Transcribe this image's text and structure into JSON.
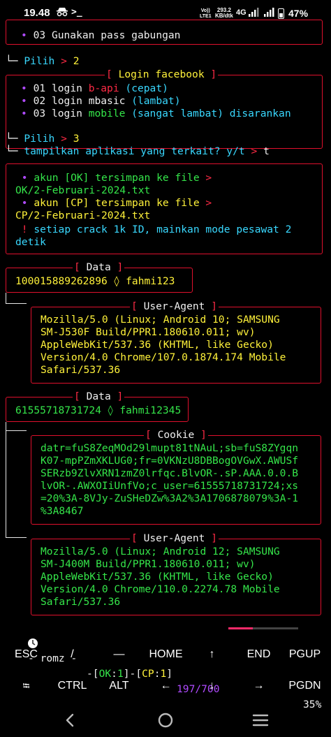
{
  "status": {
    "time": "19.48",
    "volte_top": "Vo))",
    "volte_bottom": "LTE1",
    "speed_top": "293.2",
    "speed_bottom": "KB/dtk",
    "network": "4G",
    "battery": "47%"
  },
  "terminal": {
    "l_opt3_bullet": "•",
    "l_opt3_text": "03 Gunakan pass gabungan",
    "pilih1_prefix": "└─ ",
    "pilih1_label": "Pilih",
    "pilih1_arrow": ">",
    "pilih1_value": "2",
    "login_title_left": "[",
    "login_title": "Login facebook",
    "login_title_right": "]",
    "login_items": [
      {
        "num": "01",
        "a": "login ",
        "b": "b-api",
        "c": " (cepat)"
      },
      {
        "num": "02",
        "a": "login ",
        "b": "mbasic",
        "c": " (lambat)"
      },
      {
        "num": "03",
        "a": "login ",
        "b": "mobile",
        "c": " (sangat lambat) disarankan"
      }
    ],
    "pilih2_label": "Pilih",
    "pilih2_arrow": ">",
    "pilih2_value": "3",
    "tampil_text": "tampilkan aplikasi yang terkait? y/t",
    "tampil_arrow": ">",
    "tampil_value": "t",
    "info_ok_1": "akun [OK] tersimpan ke file",
    "info_ok_arrow": ">",
    "info_ok_2": "OK/2-Februari-2024.txt",
    "info_cp_1": "akun [CP] tersimpan ke file",
    "info_cp_arrow": ">",
    "info_cp_2": "CP/2-Februari-2024.txt",
    "info_warn_mark": "!",
    "info_warn_1": "setiap crack 1k ID, mainkan mode pesawat 2",
    "info_warn_2": "detik",
    "data1_title": "Data",
    "data1_value": "100015889262896 ◊ fahmi123",
    "ua1_title": "User-Agent",
    "ua1_lines": [
      "Mozilla/5.0 (Linux; Android 10; SAMSUNG",
      "SM-J530F Build/PPR1.180610.011; wv)",
      "AppleWebKit/537.36 (KHTML, like Gecko)",
      "Version/4.0 Chrome/107.0.1874.174 Mobile",
      "Safari/537.36"
    ],
    "data2_title": "Data",
    "data2_value": "61555718731724 ◊ fahmi12345",
    "cookie_title": "Cookie",
    "cookie_lines": [
      "datr=fuS8ZeqMOd29lmupt81tNAuL;sb=fuS8ZYgqn",
      "K07-mpPZmXKLUG0;fr=0VKNzU8DBBogOVGwX.AWUSf",
      "SERzb9ZlvXRN1zmZ0lrfqc.BlvOR-.sP.AAA.0.0.B",
      "lvOR-.AWXOIiUnfVo;c_user=61555718731724;xs",
      "=20%3A-8VJy-ZuSHeDZw%3A2%3A1706878079%3A-1",
      "%3A8467"
    ],
    "ua2_title": "User-Agent",
    "ua2_lines": [
      "Mozilla/5.0 (Linux; Android 12; SAMSUNG",
      "SM-J400M Build/PPR1.180610.011; wv)",
      "AppleWebKit/537.36 (KHTML, like Gecko)",
      "Version/4.0 Chrome/110.0.2274.78 Mobile",
      "Safari/537.36"
    ]
  },
  "progress": {
    "name": "- romz -",
    "ok_label": "OK",
    "ok_count": "1",
    "cp_label": "CP",
    "cp_count": "1",
    "count": "197/700",
    "fraction": 0.35,
    "percent": "35%"
  },
  "keys": {
    "row1": [
      "ESC",
      "/",
      "—",
      "HOME",
      "↑",
      "END",
      "PGUP"
    ],
    "row2": [
      "⭾",
      "CTRL",
      "ALT",
      "←",
      "↓",
      "→",
      "PGDN"
    ]
  },
  "colors": {
    "accent_red": "#e0102d",
    "green": "#35e64a",
    "yellow": "#fff23a",
    "cyan": "#39d8ff",
    "purple": "#b04bff"
  }
}
